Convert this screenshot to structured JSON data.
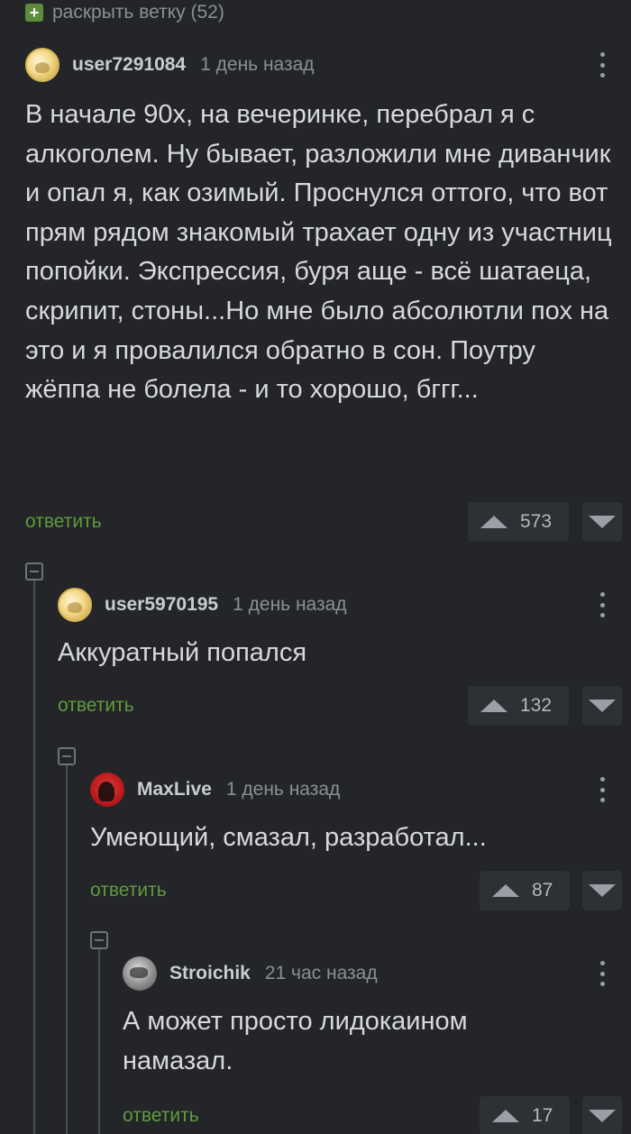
{
  "thread": {
    "expand_label": "раскрыть ветку (52)"
  },
  "comments": [
    {
      "username": "user7291084",
      "time": "1 день назад",
      "text": "В начале 90х, на вечеринке, перебрал я с алкоголем. Ну бывает, разложили мне диванчик и опал я, как озимый. Проснулся оттого, что вот прям рядом знакомый трахает одну из участниц попойки. Экспрессия, буря аще - всё шатаеца, скрипит, стоны...Но мне было абсолютли пох на это и я провалился обратно в сон. Поутру жёппа не болела - и то хорошо, бггг...",
      "reply_label": "ответить",
      "score": "573"
    },
    {
      "username": "user5970195",
      "time": "1 день назад",
      "text": "Аккуратный попался",
      "reply_label": "ответить",
      "score": "132"
    },
    {
      "username": "MaxLive",
      "time": "1 день назад",
      "text": "Умеющий, смазал, разработал...",
      "reply_label": "ответить",
      "score": "87"
    },
    {
      "username": "Stroichik",
      "time": "21 час назад",
      "text": "А может просто лидокаином намазал.",
      "reply_label": "ответить",
      "score": "17"
    }
  ],
  "icons": {
    "expand": "plus-icon",
    "collapse": "minus-icon",
    "more": "more-vertical-icon",
    "upvote": "arrow-up-icon",
    "downvote": "arrow-down-icon"
  },
  "colors": {
    "background": "#232528",
    "reply_link": "#5f9c3c",
    "expand_icon": "#5e8c3d",
    "vote_box": "#2d3034"
  }
}
